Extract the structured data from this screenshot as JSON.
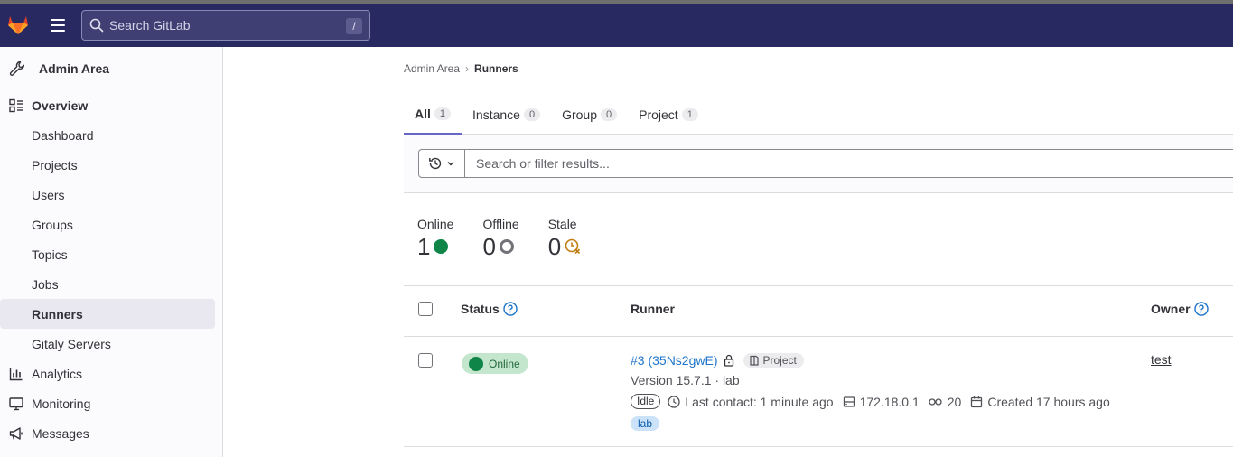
{
  "topbar": {
    "search_placeholder": "Search GitLab",
    "shortcut_key": "/"
  },
  "sidebar": {
    "title": "Admin Area",
    "overview_label": "Overview",
    "overview_items": [
      "Dashboard",
      "Projects",
      "Users",
      "Groups",
      "Topics",
      "Jobs",
      "Runners",
      "Gitaly Servers"
    ],
    "active_item": "Runners",
    "sections": [
      {
        "label": "Analytics",
        "icon": "chart-icon"
      },
      {
        "label": "Monitoring",
        "icon": "monitor-icon"
      },
      {
        "label": "Messages",
        "icon": "megaphone-icon"
      }
    ]
  },
  "breadcrumb": {
    "parent": "Admin Area",
    "current": "Runners"
  },
  "tabs": [
    {
      "label": "All",
      "count": "1"
    },
    {
      "label": "Instance",
      "count": "0"
    },
    {
      "label": "Group",
      "count": "0"
    },
    {
      "label": "Project",
      "count": "1"
    }
  ],
  "filter": {
    "placeholder": "Search or filter results..."
  },
  "stats": [
    {
      "label": "Online",
      "value": "1",
      "color": "#108548"
    },
    {
      "label": "Offline",
      "value": "0",
      "color": "#737278"
    },
    {
      "label": "Stale",
      "value": "0",
      "color": "#c17d10"
    }
  ],
  "table": {
    "headers": {
      "status": "Status",
      "runner": "Runner",
      "owner": "Owner"
    },
    "rows": [
      {
        "status": "Online",
        "runner_id": "#3 (35Ns2gwE)",
        "runner_type": "Project",
        "version": "Version 15.7.1 · lab",
        "state": "Idle",
        "last_contact": "Last contact: 1 minute ago",
        "ip": "172.18.0.1",
        "jobs": "20",
        "created": "Created 17 hours ago",
        "tag": "lab",
        "owner": "test"
      }
    ]
  }
}
